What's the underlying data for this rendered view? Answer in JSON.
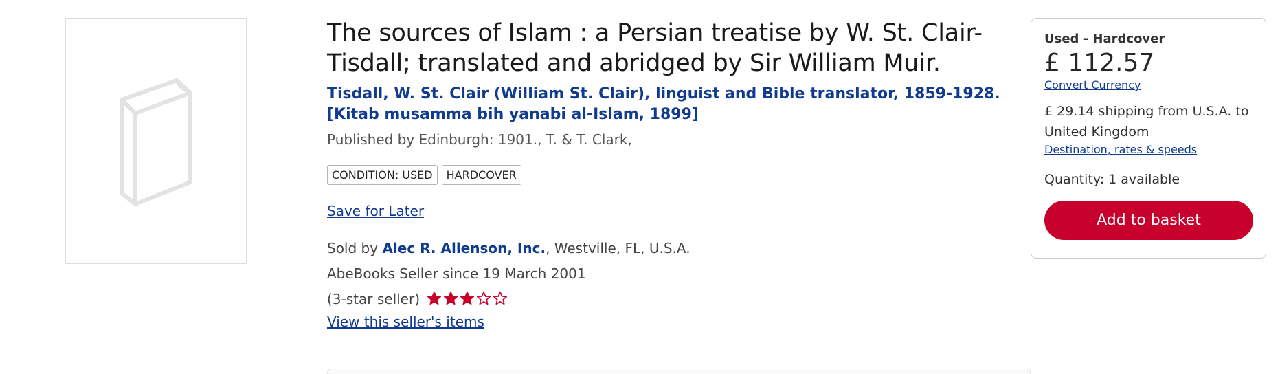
{
  "book": {
    "title": "The sources of Islam : a Persian treatise by W. St. Clair-Tisdall; translated and abridged by Sir William Muir.",
    "author": "Tisdall, W. St. Clair (William St. Clair), linguist and Bible translator, 1859-1928. [Kitab musamma bih yanabi al-Islam, 1899]",
    "publisher": "Published by Edinburgh: 1901., T. & T. Clark,",
    "cover_icon": "book-placeholder-icon"
  },
  "badges": [
    "CONDITION: USED",
    "HARDCOVER"
  ],
  "actions": {
    "save_for_later": "Save for Later"
  },
  "seller": {
    "sold_by_prefix": "Sold by ",
    "name": "Alec R. Allenson, Inc.",
    "location": ", Westville, FL, U.S.A.",
    "since": "AbeBooks Seller since 19 March 2001",
    "rating_text": "(3-star seller)",
    "rating": 3,
    "rating_max": 5,
    "view_items": "View this seller's items"
  },
  "buybox": {
    "condition": "Used - Hardcover",
    "price": "£ 112.57",
    "convert_currency": "Convert Currency",
    "shipping": "£ 29.14 shipping from U.S.A. to United Kingdom",
    "destination_link": "Destination, rates & speeds",
    "quantity": "Quantity: 1 available",
    "add_to_basket": "Add to basket"
  },
  "colors": {
    "link": "#113b8f",
    "accent": "#c8002c",
    "star": "#c8002c",
    "placeholder": "#dedede"
  }
}
